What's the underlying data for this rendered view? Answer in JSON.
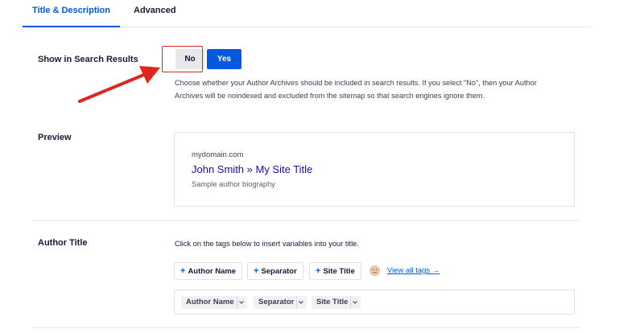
{
  "tabs": [
    {
      "label": "Title & Description",
      "active": true
    },
    {
      "label": "Advanced",
      "active": false
    }
  ],
  "search_results": {
    "label": "Show in Search Results",
    "no_label": "No",
    "yes_label": "Yes",
    "selected": "No",
    "help_line1": "Choose whether your Author Archives should be included in search results. If you select \"No\", then your Author",
    "help_line2": "Archives will be noindexed and excluded from the sitemap so that search engines ignore them."
  },
  "preview": {
    "label": "Preview",
    "domain": "mydomain.com",
    "title": "John Smith » My Site Title",
    "description": "Sample author biography"
  },
  "author_title": {
    "label": "Author Title",
    "hint": "Click on the tags below to insert variables into your title.",
    "tag_buttons": [
      "Author Name",
      "Separator",
      "Site Title"
    ],
    "plus_symbol": "+",
    "view_all_label": "View all tags →",
    "chips": [
      "Author Name",
      "Separator",
      "Site Title"
    ]
  },
  "colors": {
    "accent": "#005ae0",
    "highlight": "#e0241e",
    "link": "#1a0dab"
  }
}
